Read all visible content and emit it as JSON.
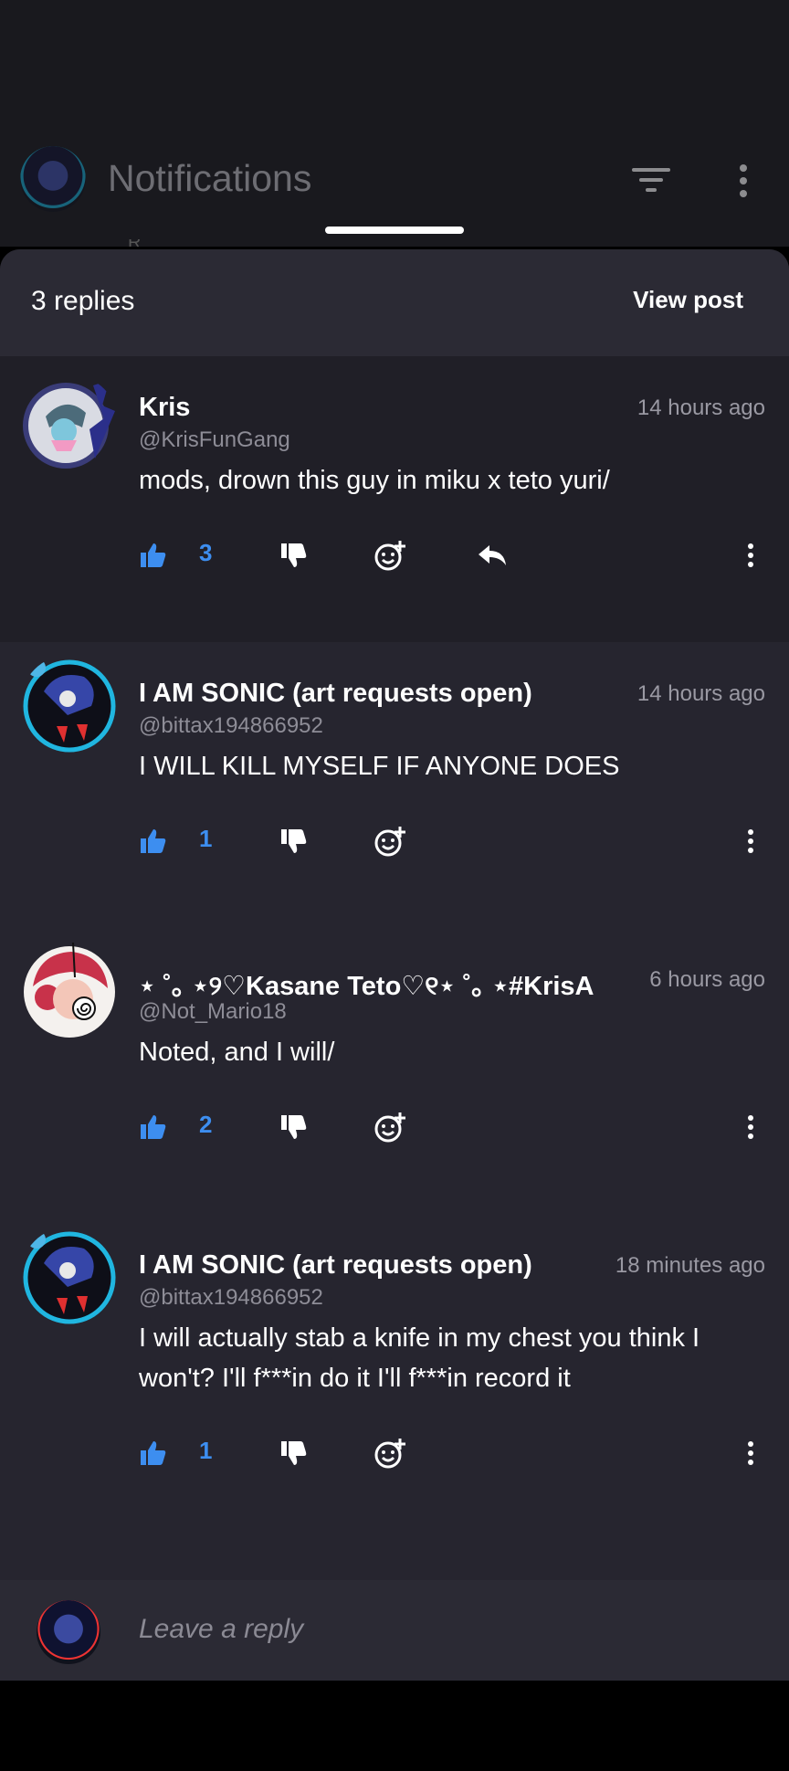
{
  "header": {
    "title": "Notifications",
    "hint_text": "R"
  },
  "sheet": {
    "replies_count": "3 replies",
    "view_post": "View post"
  },
  "comments": [
    {
      "name": "Kris",
      "handle": "@KrisFunGang",
      "time": "14 hours ago",
      "body": "mods, drown this guy in miku x teto yuri/",
      "likes": "3",
      "has_reply": true
    },
    {
      "name": "I AM SONIC (art requests open)",
      "handle": "@bittax194866952",
      "time": "14 hours ago",
      "body": "I WILL KILL MYSELF IF ANYONE DOES",
      "likes": "1"
    },
    {
      "name": "⋆ ˚｡ ⋆୨♡Kasane Teto♡୧⋆ ˚｡ ⋆#KrisA",
      "handle": "@Not_Mario18",
      "time": "6 hours ago",
      "body": "Noted, and I will/",
      "likes": "2"
    },
    {
      "name": "I AM SONIC (art requests open)",
      "handle": "@bittax194866952",
      "time": "18 minutes ago",
      "body": "I will actually stab a knife in my chest you think I won't? I'll f***in do it I'll f***in record it",
      "likes": "1"
    }
  ],
  "reply": {
    "placeholder": "Leave a reply"
  },
  "colors": {
    "accent_like": "#3d8ef0",
    "sheet_bg": "#26252f",
    "first_comment_bg": "#201f27"
  },
  "icons": [
    "thumbs-up-icon",
    "thumbs-down-icon",
    "add-emoji-icon",
    "reply-icon",
    "more-vertical-icon",
    "filter-icon"
  ]
}
